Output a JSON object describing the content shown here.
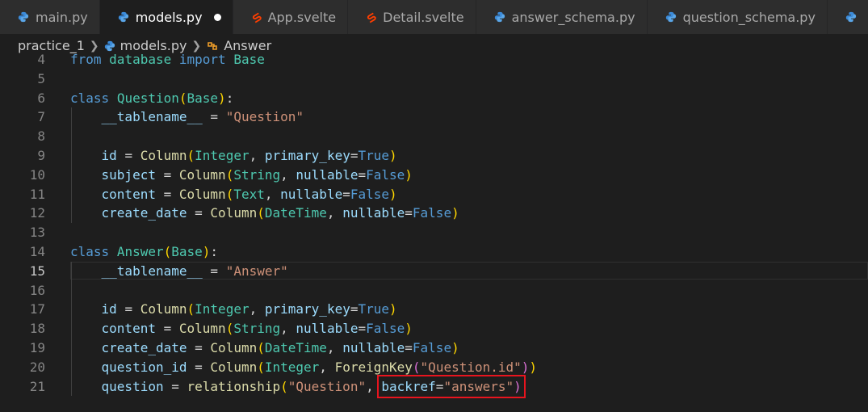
{
  "tabs": [
    {
      "name": "main.py",
      "type": "python",
      "active": false,
      "modified": false
    },
    {
      "name": "models.py",
      "type": "python",
      "active": true,
      "modified": true
    },
    {
      "name": "App.svelte",
      "type": "svelte",
      "active": false,
      "modified": false
    },
    {
      "name": "Detail.svelte",
      "type": "svelte",
      "active": false,
      "modified": false
    },
    {
      "name": "answer_schema.py",
      "type": "python",
      "active": false,
      "modified": false
    },
    {
      "name": "question_schema.py",
      "type": "python",
      "active": false,
      "modified": false
    }
  ],
  "breadcrumb": {
    "folder": "practice_1",
    "file": "models.py",
    "symbol": "Answer"
  },
  "current_line": 15,
  "lines": [
    {
      "n": "4",
      "code": "from database import Base"
    },
    {
      "n": "5",
      "code": ""
    },
    {
      "n": "6",
      "code": "class Question(Base):"
    },
    {
      "n": "7",
      "code": "    __tablename__ = \"Question\""
    },
    {
      "n": "8",
      "code": ""
    },
    {
      "n": "9",
      "code": "    id = Column(Integer, primary_key=True)"
    },
    {
      "n": "10",
      "code": "    subject = Column(String, nullable=False)"
    },
    {
      "n": "11",
      "code": "    content = Column(Text, nullable=False)"
    },
    {
      "n": "12",
      "code": "    create_date = Column(DateTime, nullable=False)"
    },
    {
      "n": "13",
      "code": ""
    },
    {
      "n": "14",
      "code": "class Answer(Base):"
    },
    {
      "n": "15",
      "code": "    __tablename__ = \"Answer\""
    },
    {
      "n": "16",
      "code": ""
    },
    {
      "n": "17",
      "code": "    id = Column(Integer, primary_key=True)"
    },
    {
      "n": "18",
      "code": "    content = Column(String, nullable=False)"
    },
    {
      "n": "19",
      "code": "    create_date = Column(DateTime, nullable=False)"
    },
    {
      "n": "20",
      "code": "    question_id = Column(Integer, ForeignKey(\"Question.id\"))"
    },
    {
      "n": "21",
      "code": "    question = relationship(\"Question\", backref=\"answers\")"
    }
  ],
  "highlighted_fragment": "backref=\"answers\")",
  "colors": {
    "editor_bg": "#1e1e1e",
    "keyword": "#569cd6",
    "class": "#4ec9b0",
    "variable": "#9cdcfe",
    "string": "#ce9178",
    "annotation_box": "#e8141e"
  }
}
